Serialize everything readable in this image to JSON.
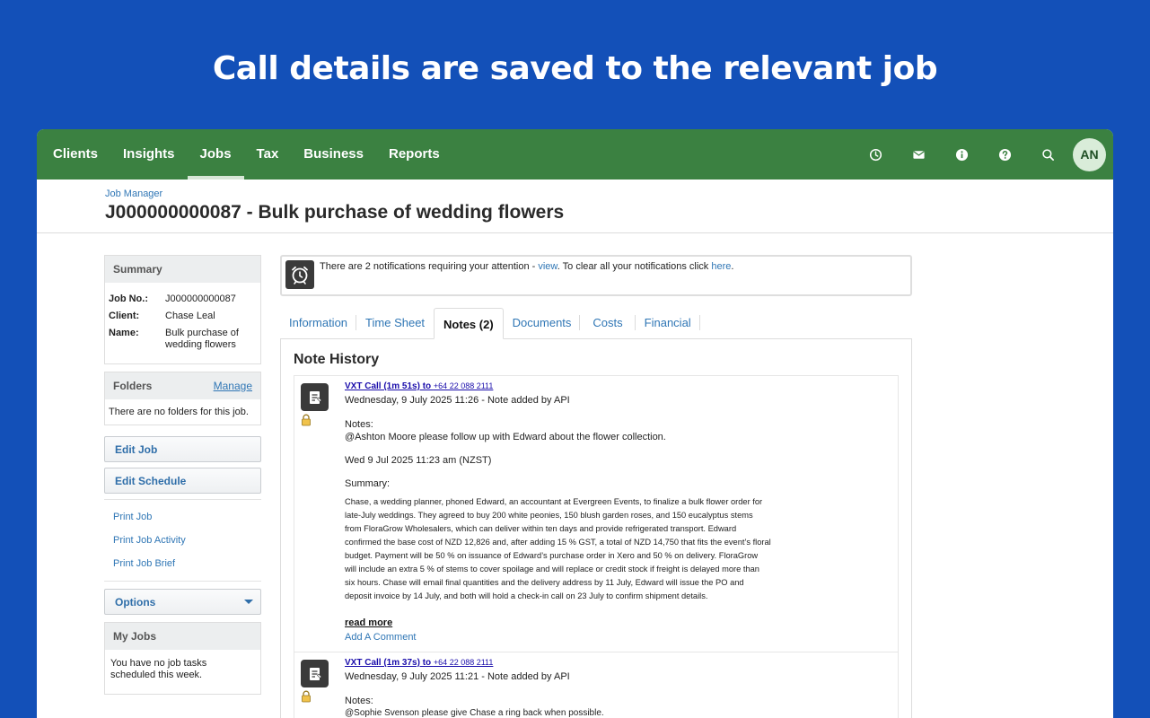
{
  "headline": "Call details are saved to the relevant job",
  "nav": {
    "items": [
      "Clients",
      "Insights",
      "Jobs",
      "Tax",
      "Business",
      "Reports"
    ],
    "active": "Jobs",
    "avatar": "AN"
  },
  "page": {
    "breadcrumb": "Job Manager",
    "title": "J000000000087 - Bulk purchase of wedding flowers"
  },
  "summary": {
    "heading": "Summary",
    "job_no_label": "Job No.:",
    "job_no": "J000000000087",
    "client_label": "Client:",
    "client": "Chase Leal",
    "name_label": "Name:",
    "name": "Bulk purchase of wedding flowers"
  },
  "folders": {
    "heading": "Folders",
    "manage": "Manage",
    "empty": "There are no folders for this job."
  },
  "actions": {
    "edit_job": "Edit Job",
    "edit_schedule": "Edit Schedule",
    "print_job": "Print Job",
    "print_activity": "Print Job Activity",
    "print_brief": "Print Job Brief",
    "options": "Options"
  },
  "my_jobs": {
    "heading": "My Jobs",
    "empty": "You have no job tasks scheduled this week."
  },
  "notification": {
    "prefix": "There are 2 notifications requiring your attention - ",
    "view": "view",
    "middle": ". To clear all your notifications click ",
    "here": "here",
    "suffix": "."
  },
  "tabs": [
    "Information",
    "Time Sheet",
    "Notes (2)",
    "Documents",
    "Costs",
    "Financial"
  ],
  "notes": {
    "heading": "Note History",
    "items": [
      {
        "title": "VXT Call (1m 51s) to ",
        "phone": "+64 22 088 2111",
        "meta": "Wednesday, 9 July 2025 11:26 - Note added by API",
        "notes_label": "Notes:",
        "notes_text": "@Ashton Moore please follow up with Edward about the flower collection.",
        "date": "Wed 9 Jul 2025 11:23 am (NZST)",
        "summary_label": "Summary:",
        "summary_lines": [
          "Chase, a wedding planner, phoned Edward, an accountant at Evergreen Events, to finalize a bulk flower order for",
          "late-July weddings. They agreed to buy 200 white peonies, 150 blush garden roses, and 150 eucalyptus stems",
          "from FloraGrow Wholesalers, which can deliver within ten days and provide refrigerated transport. Edward",
          "confirmed the base cost of NZD 12,826 and, after adding 15 % GST, a total of NZD 14,750 that fits the event’s floral",
          "budget. Payment will be 50 % on issuance of Edward’s purchase order in Xero and 50 % on delivery. FloraGrow",
          "will include an extra 5 % of stems to cover spoilage and will replace or credit stock if freight is delayed more than",
          "six hours. Chase will email final quantities and the delivery address by 11 July, Edward will issue the PO and",
          "deposit invoice by 14 July, and both will hold a check-in call on 23 July to confirm shipment details."
        ],
        "read_more": "read more",
        "add_comment": "Add A Comment"
      },
      {
        "title": "VXT Call (1m 37s) to ",
        "phone": "+64 22 088 2111",
        "meta": "Wednesday, 9 July 2025 11:21 - Note added by API",
        "notes_label": "Notes:",
        "notes_text": "@Sophie Svenson please give Chase a ring back when possible."
      }
    ]
  }
}
